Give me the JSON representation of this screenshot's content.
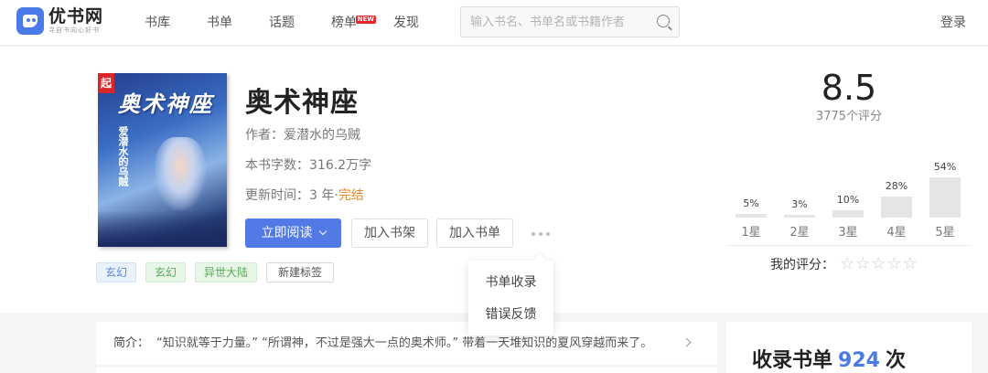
{
  "header": {
    "logo_name": "优书网",
    "logo_slogan": "寻自书向心好书",
    "nav": [
      {
        "label": "书库"
      },
      {
        "label": "书单"
      },
      {
        "label": "话题"
      },
      {
        "label": "榜单",
        "badge": "NEW"
      },
      {
        "label": "发现"
      }
    ],
    "search_placeholder": "输入书名、书单名或书籍作者",
    "login": "登录"
  },
  "book": {
    "cover": {
      "badge": "起",
      "title": "奥术神座",
      "author": "爱潜水的乌贼"
    },
    "title": "奥术神座",
    "author": "作者：爱潜水的乌贼",
    "word_count": "本书字数：316.2万字",
    "update_prefix": "更新时间：3 年·",
    "status": "完结",
    "read_button": "立即阅读",
    "add_shelf": "加入书架",
    "add_list": "加入书单",
    "tags": [
      "玄幻",
      "玄幻",
      "异世大陆"
    ],
    "new_tag": "新建标签"
  },
  "dropdown": {
    "items": [
      "书单收录",
      "错误反馈"
    ]
  },
  "rating": {
    "score": "8.5",
    "count": "3775个评分",
    "distribution": [
      {
        "label": "1星",
        "pct_text": "5%",
        "pct": 5
      },
      {
        "label": "2星",
        "pct_text": "3%",
        "pct": 3
      },
      {
        "label": "3星",
        "pct_text": "10%",
        "pct": 10
      },
      {
        "label": "4星",
        "pct_text": "28%",
        "pct": 28
      },
      {
        "label": "5星",
        "pct_text": "54%",
        "pct": 54
      }
    ],
    "my_rating_label": "我的评分：",
    "stars": 5
  },
  "intro": {
    "label": "简介：",
    "text": "“知识就等于力量。” “所谓神，不过是强大一点的奥术师。” 带着一天堆知识的夏风穿越而来了。"
  },
  "collect": {
    "prefix": "收录书单",
    "count": "924",
    "suffix": "次"
  }
}
